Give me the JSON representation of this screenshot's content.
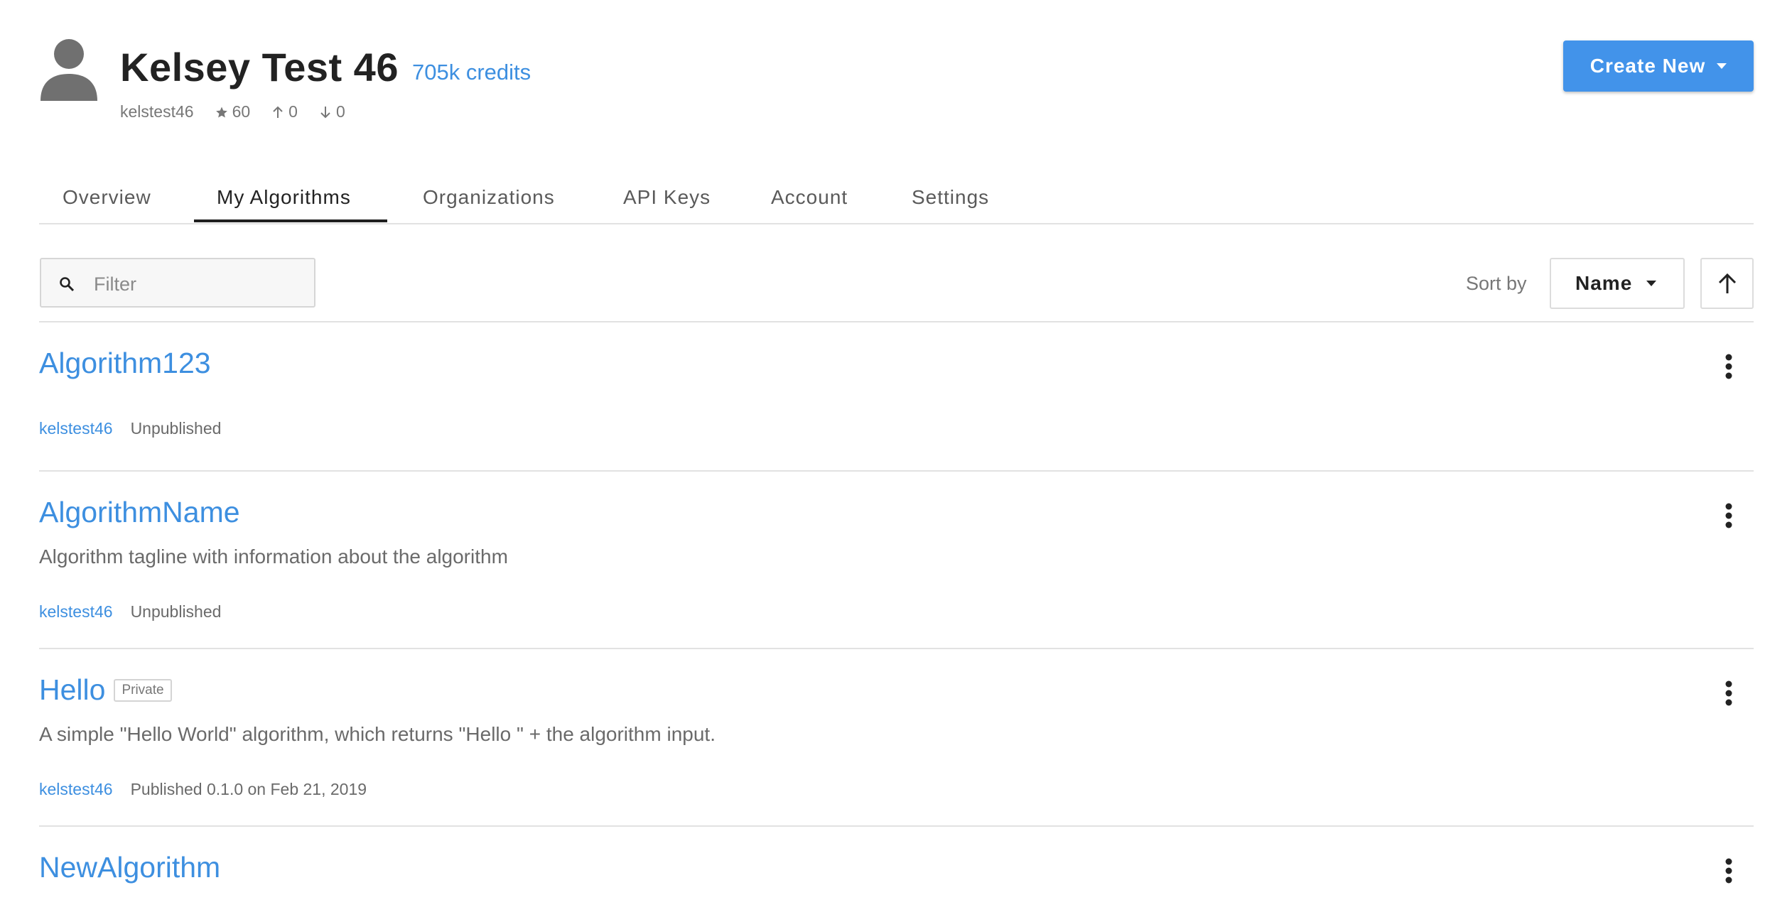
{
  "profile": {
    "name": "Kelsey Test 46",
    "credits": "705k credits",
    "username": "kelstest46",
    "stars": "60",
    "followers": "0",
    "following": "0"
  },
  "create_button": {
    "label": "Create New"
  },
  "tabs": [
    {
      "label": "Overview",
      "active": false
    },
    {
      "label": "My Algorithms",
      "active": true
    },
    {
      "label": "Organizations",
      "active": false
    },
    {
      "label": "API Keys",
      "active": false
    },
    {
      "label": "Account",
      "active": false
    },
    {
      "label": "Settings",
      "active": false
    }
  ],
  "filter": {
    "placeholder": "Filter",
    "value": ""
  },
  "sort": {
    "label": "Sort by",
    "value": "Name",
    "direction": "ascending"
  },
  "algorithms": [
    {
      "name": "Algorithm123",
      "badge": "",
      "description": "",
      "owner": "kelstest46",
      "status": "Unpublished"
    },
    {
      "name": "AlgorithmName",
      "badge": "",
      "description": "Algorithm tagline with information about the algorithm",
      "owner": "kelstest46",
      "status": "Unpublished"
    },
    {
      "name": "Hello",
      "badge": "Private",
      "description": "A simple \"Hello World\" algorithm, which returns \"Hello \" + the algorithm input.",
      "owner": "kelstest46",
      "status": "Published 0.1.0 on Feb 21, 2019"
    },
    {
      "name": "NewAlgorithm",
      "badge": "",
      "description": "",
      "owner": "",
      "status": ""
    }
  ],
  "colors": {
    "accent": "#4293ea",
    "link": "#3d8fe0",
    "divider": "#e2e2e2"
  },
  "icons": {
    "avatar": "user-avatar-icon",
    "star": "star-icon",
    "followers": "arrow-up-icon",
    "following": "arrow-down-icon",
    "search": "search-icon",
    "caret": "caret-down-icon",
    "sort_direction": "arrow-up-icon",
    "more": "more-vertical-icon"
  }
}
